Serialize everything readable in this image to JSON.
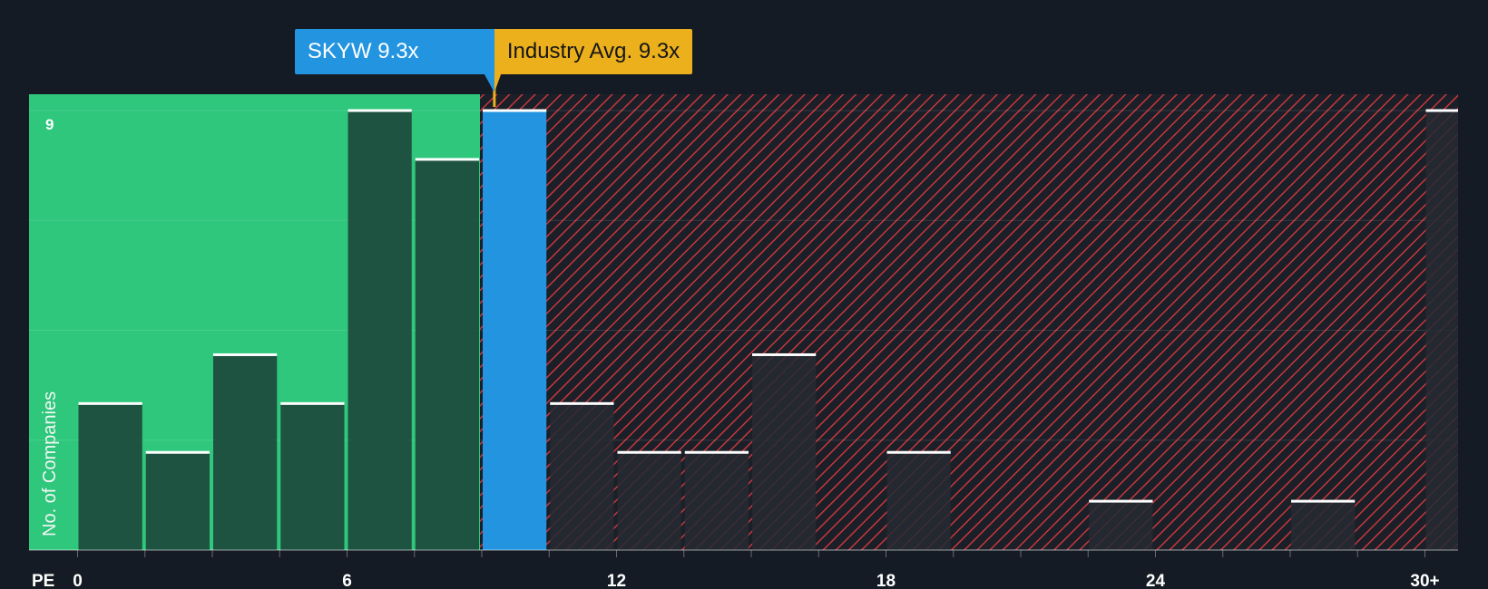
{
  "chart_data": {
    "type": "bar",
    "x_axis_label": "PE",
    "ylabel": "No. of Companies",
    "x_ticks": [
      "0",
      "6",
      "12",
      "18",
      "24",
      "30+"
    ],
    "y_ticks": [
      "9"
    ],
    "ylim": [
      0,
      9
    ],
    "xlim": [
      -1.1,
      30.8
    ],
    "bin_width": 1.5,
    "bins": [
      {
        "x": 0,
        "value": 3,
        "zone": "below"
      },
      {
        "x": 1.5,
        "value": 2,
        "zone": "below"
      },
      {
        "x": 3,
        "value": 4,
        "zone": "below"
      },
      {
        "x": 4.5,
        "value": 3,
        "zone": "below"
      },
      {
        "x": 6,
        "value": 9,
        "zone": "below"
      },
      {
        "x": 7.5,
        "value": 8,
        "zone": "below"
      },
      {
        "x": 9,
        "value": 9,
        "zone": "company"
      },
      {
        "x": 10.5,
        "value": 3,
        "zone": "above"
      },
      {
        "x": 12,
        "value": 2,
        "zone": "above"
      },
      {
        "x": 13.5,
        "value": 2,
        "zone": "above"
      },
      {
        "x": 15,
        "value": 4,
        "zone": "above"
      },
      {
        "x": 16.5,
        "value": 0,
        "zone": "above"
      },
      {
        "x": 18,
        "value": 2,
        "zone": "above"
      },
      {
        "x": 19.5,
        "value": 0,
        "zone": "above"
      },
      {
        "x": 21,
        "value": 0,
        "zone": "above"
      },
      {
        "x": 22.5,
        "value": 1,
        "zone": "above"
      },
      {
        "x": 24,
        "value": 0,
        "zone": "above"
      },
      {
        "x": 25.5,
        "value": 0,
        "zone": "above"
      },
      {
        "x": 27,
        "value": 1,
        "zone": "above"
      },
      {
        "x": 28.5,
        "value": 0,
        "zone": "above"
      },
      {
        "x": 30,
        "value": 9,
        "zone": "above"
      }
    ],
    "company": {
      "label": "SKYW 9.3x",
      "pe": 9.3
    },
    "industry": {
      "label": "Industry Avg. 9.3x",
      "pe": 9.3
    },
    "colors": {
      "background": "#151b24",
      "below_zone": "#2ec77c",
      "below_bar": "#1e4d3f",
      "company_bar": "#2394e0",
      "above_hatch": "#c8373d",
      "above_bar": "#242a33",
      "industry": "#ebb01c",
      "cap": "#ffffff",
      "text": "#ffffff"
    }
  }
}
